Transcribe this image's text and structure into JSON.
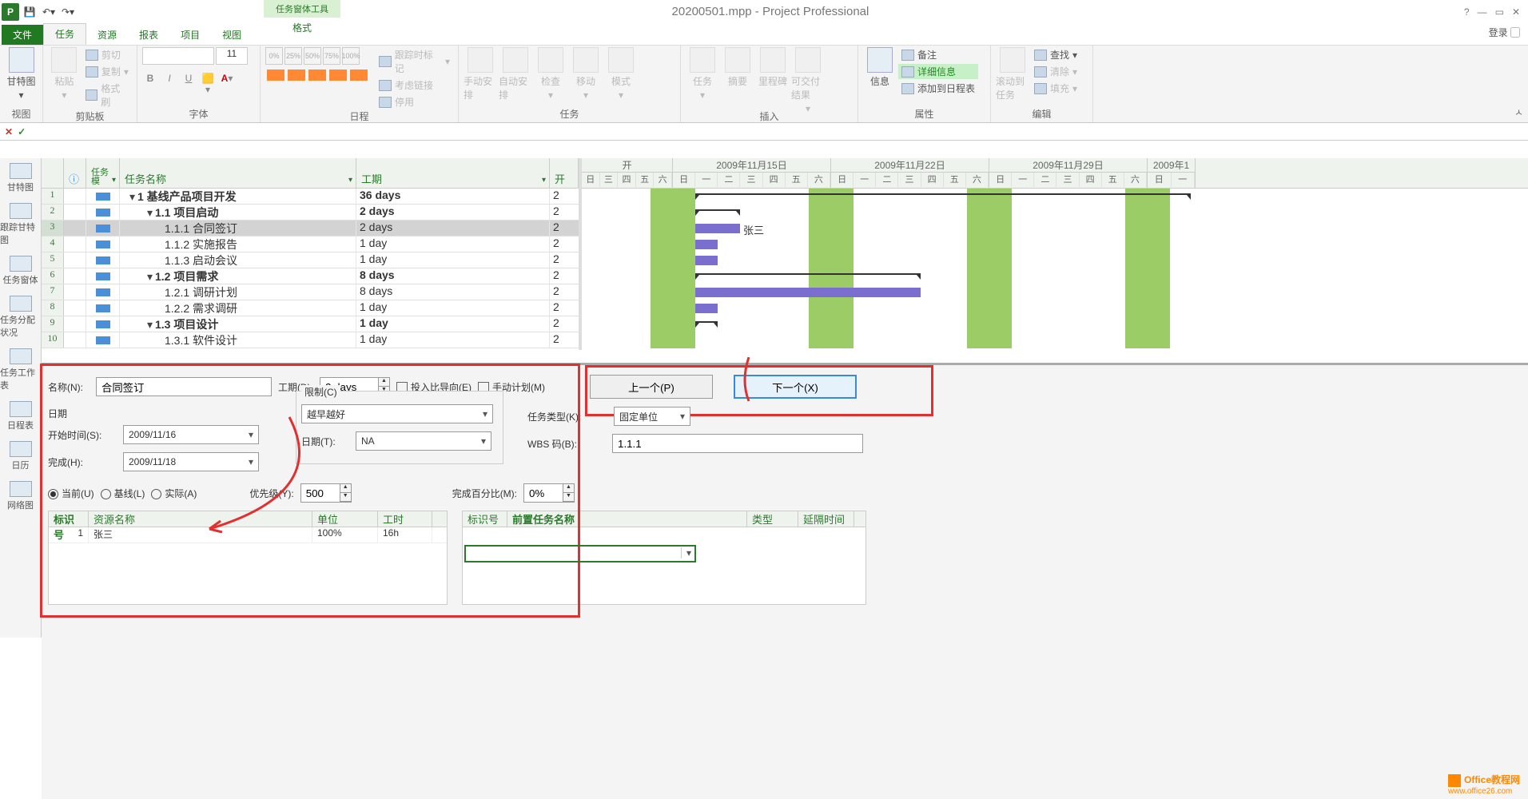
{
  "window": {
    "title": "20200501.mpp - Project Professional",
    "tool_context_title": "任务窗体工具",
    "tool_context_tab": "格式",
    "login": "登录"
  },
  "menu": {
    "file": "文件",
    "tabs": [
      "任务",
      "资源",
      "报表",
      "项目",
      "视图"
    ],
    "active": 0
  },
  "ribbon": {
    "groups": {
      "view": {
        "label": "视图",
        "gantt": "甘特图"
      },
      "clipboard": {
        "label": "剪贴板",
        "paste": "粘贴",
        "cut": "剪切",
        "copy": "复制",
        "fmt": "格式刷"
      },
      "font": {
        "label": "字体",
        "size": "11",
        "b": "B",
        "i": "I",
        "u": "U"
      },
      "schedule": {
        "label": "日程",
        "pcts": [
          "0%",
          "25%",
          "50%",
          "75%",
          "100%"
        ],
        "track": "跟踪时标记",
        "links": "考虑链接",
        "pause": "停用"
      },
      "tasks": {
        "label": "任务",
        "manual": "手动安排",
        "auto": "自动安排",
        "check": "检查",
        "move": "移动",
        "mode": "模式"
      },
      "insert": {
        "label": "插入",
        "task": "任务",
        "summary": "摘要",
        "milestone": "里程碑",
        "deliv": "可交付结果"
      },
      "props": {
        "label": "属性",
        "info": "信息",
        "notes": "备注",
        "details": "详细信息",
        "add_tl": "添加到日程表"
      },
      "edit": {
        "label": "编辑",
        "scroll": "滚动到任务",
        "find": "查找",
        "clear": "清除",
        "fill": "填充"
      }
    }
  },
  "viewbar": [
    {
      "name": "甘特图"
    },
    {
      "name": "跟踪甘特图"
    },
    {
      "name": "任务窗体"
    },
    {
      "name": "任务分配状况"
    },
    {
      "name": "任务工作表"
    },
    {
      "name": "日程表"
    },
    {
      "name": "日历"
    },
    {
      "name": "网络图"
    }
  ],
  "grid": {
    "headers": {
      "info": "",
      "mode": "任务模式",
      "name": "任务名称",
      "duration": "工期",
      "last": "开"
    },
    "mode_head_short": "任务模",
    "rows": [
      {
        "n": 1,
        "wbs": "1",
        "name": "基线产品项目开发",
        "dur": "36 days",
        "last": "2",
        "lvl": 0,
        "sum": true
      },
      {
        "n": 2,
        "wbs": "1.1",
        "name": "项目启动",
        "dur": "2 days",
        "last": "2",
        "lvl": 1,
        "sum": true
      },
      {
        "n": 3,
        "wbs": "1.1.1",
        "name": "合同签订",
        "dur": "2 days",
        "last": "2",
        "lvl": 2,
        "sel": true
      },
      {
        "n": 4,
        "wbs": "1.1.2",
        "name": "实施报告",
        "dur": "1 day",
        "last": "2",
        "lvl": 2
      },
      {
        "n": 5,
        "wbs": "1.1.3",
        "name": "启动会议",
        "dur": "1 day",
        "last": "2",
        "lvl": 2
      },
      {
        "n": 6,
        "wbs": "1.2",
        "name": "项目需求",
        "dur": "8 days",
        "last": "2",
        "lvl": 1,
        "sum": true
      },
      {
        "n": 7,
        "wbs": "1.2.1",
        "name": "调研计划",
        "dur": "8 days",
        "last": "2",
        "lvl": 2
      },
      {
        "n": 8,
        "wbs": "1.2.2",
        "name": "需求调研",
        "dur": "1 day",
        "last": "2",
        "lvl": 2
      },
      {
        "n": 9,
        "wbs": "1.3",
        "name": "项目设计",
        "dur": "1 day",
        "last": "2",
        "lvl": 1,
        "sum": true
      },
      {
        "n": 10,
        "wbs": "1.3.1",
        "name": "软件设计",
        "dur": "1 day",
        "last": "2",
        "lvl": 2
      }
    ]
  },
  "timeline": {
    "weeks": [
      "2009年11月15日",
      "2009年11月22日",
      "2009年11月29日",
      "2009年1"
    ],
    "pre_days": [
      "日",
      "三",
      "四",
      "五",
      "六"
    ],
    "days": [
      "日",
      "一",
      "二",
      "三",
      "四",
      "五",
      "六"
    ]
  },
  "gantt_label": "张三",
  "form": {
    "name_lbl": "名称(N):",
    "name_val": "合同签订",
    "dur_lbl": "工期(D):",
    "dur_val": "2 days",
    "effort_lbl": "投入比导向(E)",
    "manual_lbl": "手动计划(M)",
    "prev_btn": "上一个(P)",
    "next_btn": "下一个(X)",
    "dates_lbl": "日期",
    "constraint_lbl": "限制(C)",
    "start_lbl": "开始时间(S):",
    "start_val": "2009/11/16",
    "finish_lbl": "完成(H):",
    "finish_val": "2009/11/18",
    "ctype_val": "越早越好",
    "cdate_lbl": "日期(T):",
    "cdate_val": "NA",
    "ttype_lbl": "任务类型(K):",
    "ttype_val": "固定单位",
    "wbs_lbl": "WBS 码(B):",
    "wbs_val": "1.1.1",
    "cur_lbl": "当前(U)",
    "base_lbl": "基线(L)",
    "act_lbl": "实际(A)",
    "prio_lbl": "优先级(Y):",
    "prio_val": "500",
    "pct_lbl": "完成百分比(M):",
    "pct_val": "0%",
    "res_head": {
      "id": "标识号",
      "name": "资源名称",
      "unit": "单位",
      "work": "工时"
    },
    "res_rows": [
      {
        "id": "1",
        "name": "张三",
        "unit": "100%",
        "work": "16h"
      }
    ],
    "pred_head": {
      "id": "标识号",
      "name": "前置任务名称",
      "type": "类型",
      "lag": "延隔时间"
    }
  },
  "watermark": {
    "brand": "Office教程网",
    "url": "www.office26.com"
  }
}
